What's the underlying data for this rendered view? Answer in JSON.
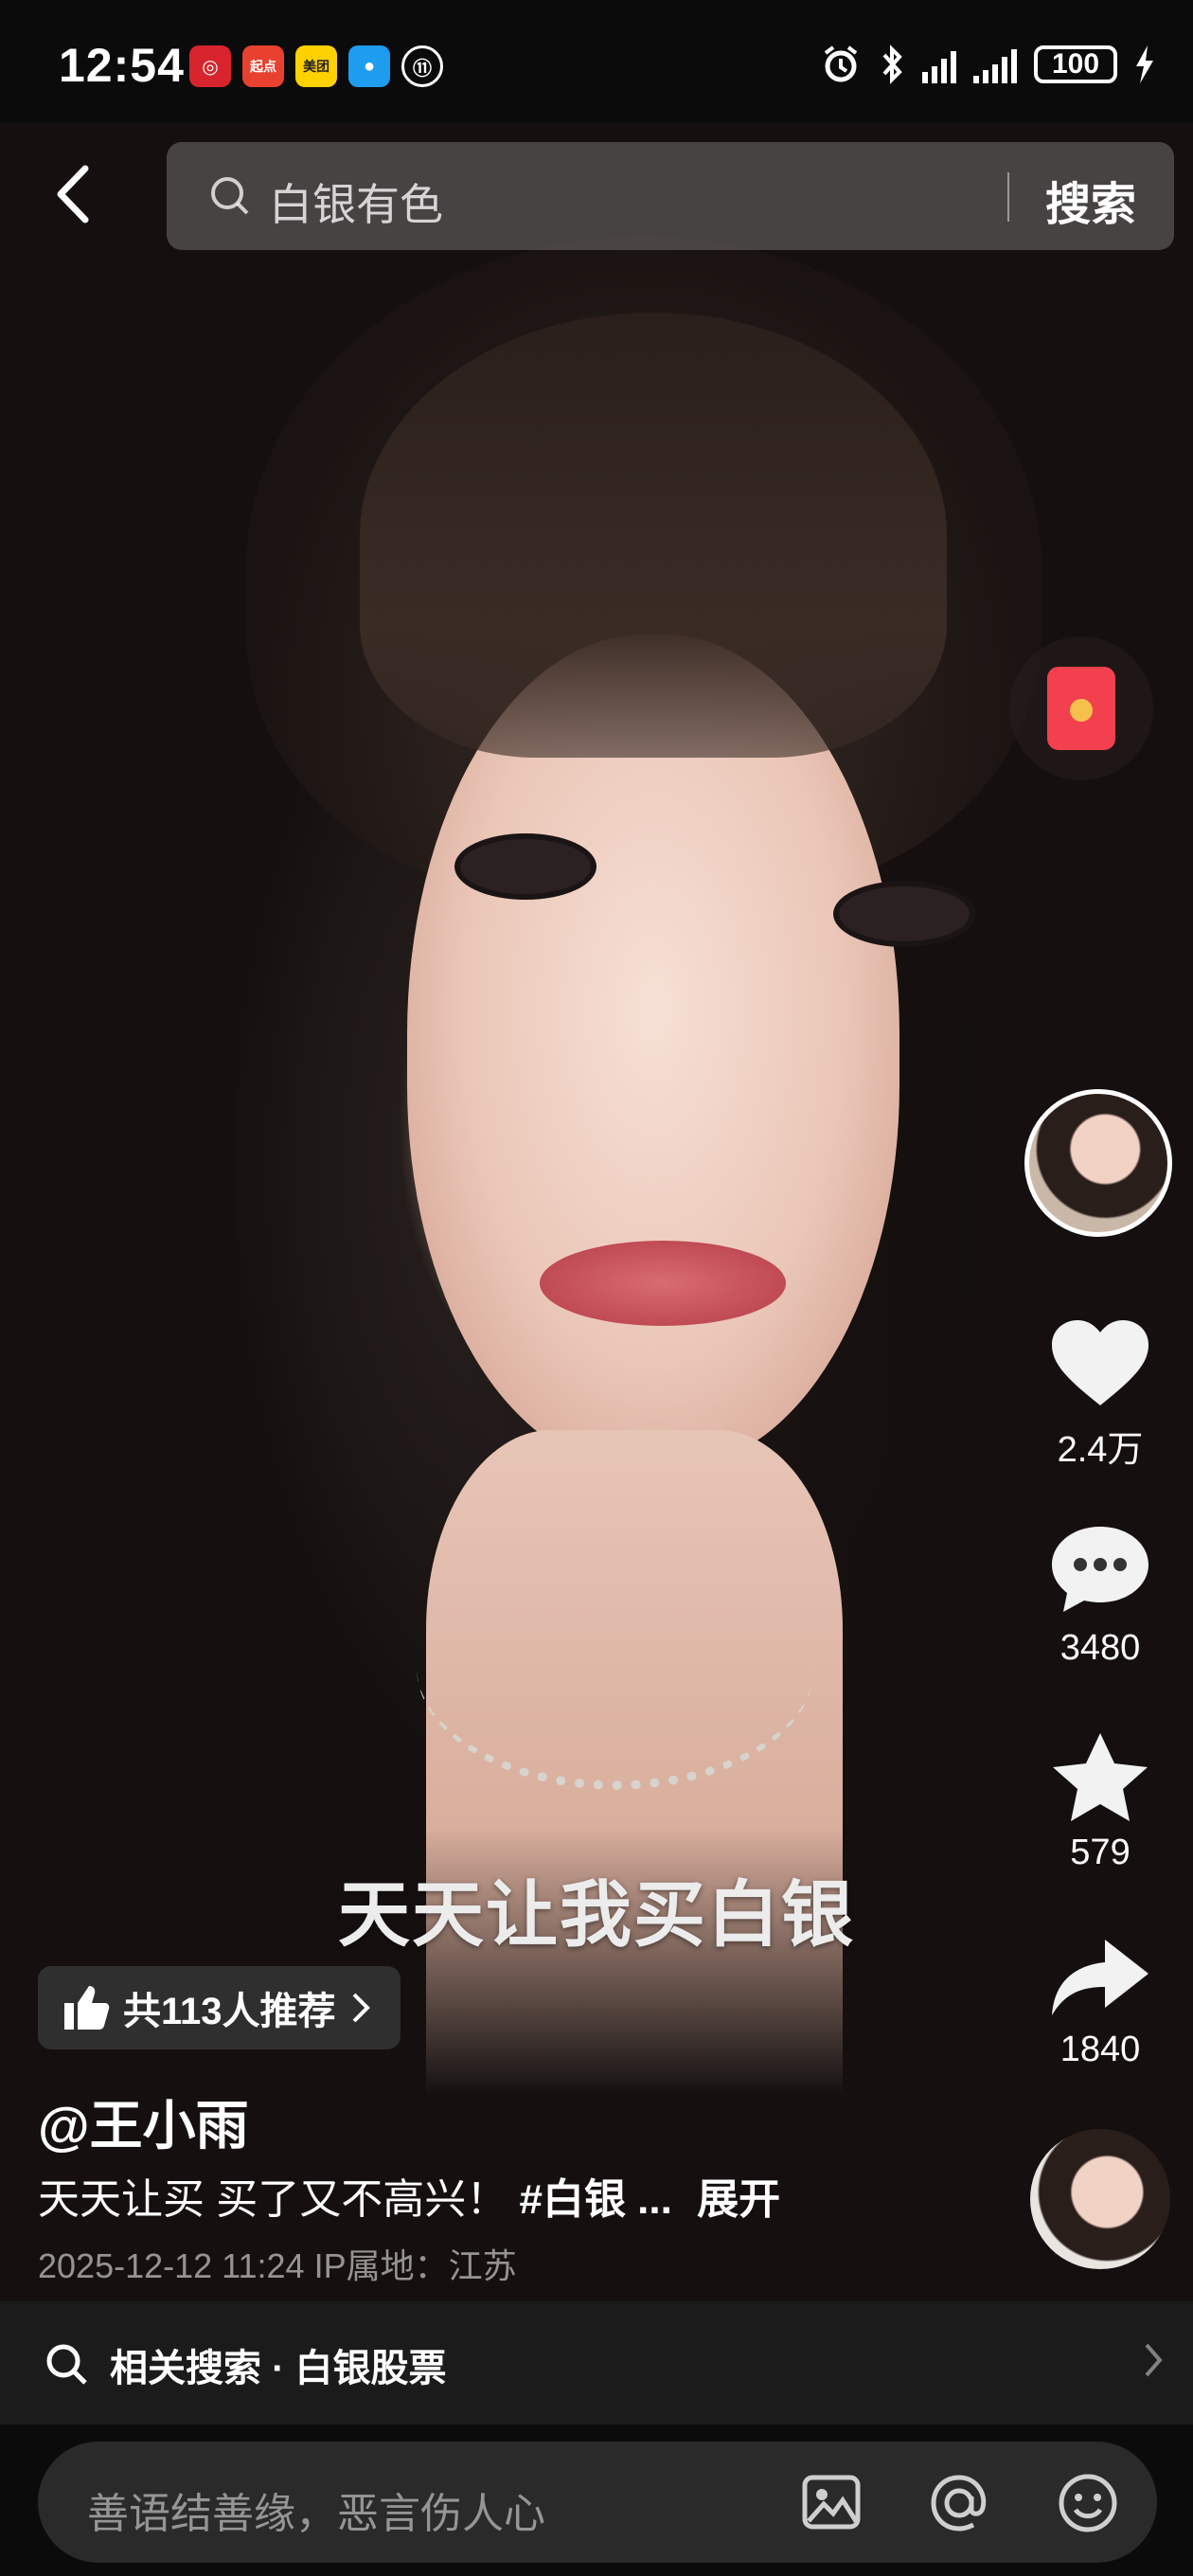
{
  "status_bar": {
    "time": "12:54",
    "app_icons": [
      {
        "name": "bank-app-icon",
        "color": "#d8242c",
        "glyph": "◎"
      },
      {
        "name": "qidian-app-icon",
        "color": "#e8412f",
        "glyph": "起点"
      },
      {
        "name": "meituan-app-icon",
        "color": "#ffd100",
        "glyph": "美团"
      },
      {
        "name": "message-app-icon",
        "color": "#1e9cf0",
        "glyph": "●"
      },
      {
        "name": "account-app-icon",
        "color": "#ffffff",
        "glyph": "⑪"
      }
    ],
    "battery": "100"
  },
  "search": {
    "query": "白银有色",
    "button": "搜索"
  },
  "right_rail": {
    "likes": "2.4万",
    "comments": "3480",
    "favorites": "579",
    "shares": "1840"
  },
  "video": {
    "subtitle": "天天让我买白银",
    "recommend": "共113人推荐",
    "username": "@王小雨",
    "description": "天天让买 买了又不高兴！",
    "hashtag": "#白银 ...",
    "expand": "展开",
    "meta": "2025-12-12 11:24   IP属地：江苏"
  },
  "related_search": {
    "label": "相关搜索 · 白银股票"
  },
  "comment_bar": {
    "placeholder": "善语结善缘，恶言伤人心"
  },
  "colors": {
    "accent_red": "#f2404f",
    "background": "#0b0b0c"
  }
}
